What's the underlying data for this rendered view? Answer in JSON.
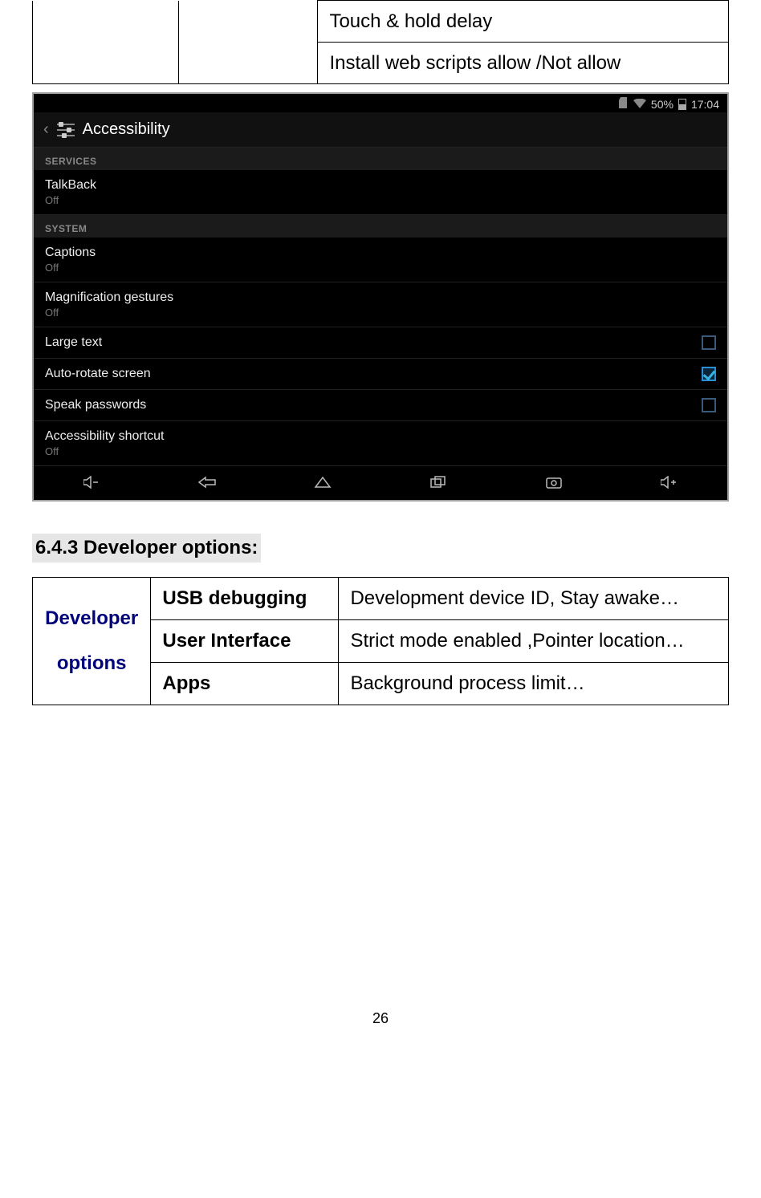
{
  "top_table": {
    "row1": "Touch & hold delay",
    "row2": "Install web scripts    allow /Not allow"
  },
  "android": {
    "status": {
      "battery_text": "50%",
      "time": "17:04"
    },
    "title": "Accessibility",
    "sections": [
      {
        "header": "SERVICES",
        "items": [
          {
            "primary": "TalkBack",
            "secondary": "Off",
            "control": null
          }
        ]
      },
      {
        "header": "SYSTEM",
        "items": [
          {
            "primary": "Captions",
            "secondary": "Off",
            "control": null
          },
          {
            "primary": "Magnification gestures",
            "secondary": "Off",
            "control": null
          },
          {
            "primary": "Large text",
            "secondary": null,
            "control": "unchecked"
          },
          {
            "primary": "Auto-rotate screen",
            "secondary": null,
            "control": "checked"
          },
          {
            "primary": "Speak passwords",
            "secondary": null,
            "control": "unchecked"
          },
          {
            "primary": "Accessibility shortcut",
            "secondary": "Off",
            "control": null
          }
        ]
      }
    ]
  },
  "section_heading": "6.4.3 Developer options:",
  "dev_table": {
    "left_label_line1": "Developer",
    "left_label_line2": "options",
    "rows": [
      {
        "mid": "USB debugging",
        "right": "Development device ID, Stay awake…"
      },
      {
        "mid": "User Interface",
        "right": "Strict mode enabled ,Pointer location…"
      },
      {
        "mid": "Apps",
        "right": "Background process limit…"
      }
    ]
  },
  "page_number": "26"
}
